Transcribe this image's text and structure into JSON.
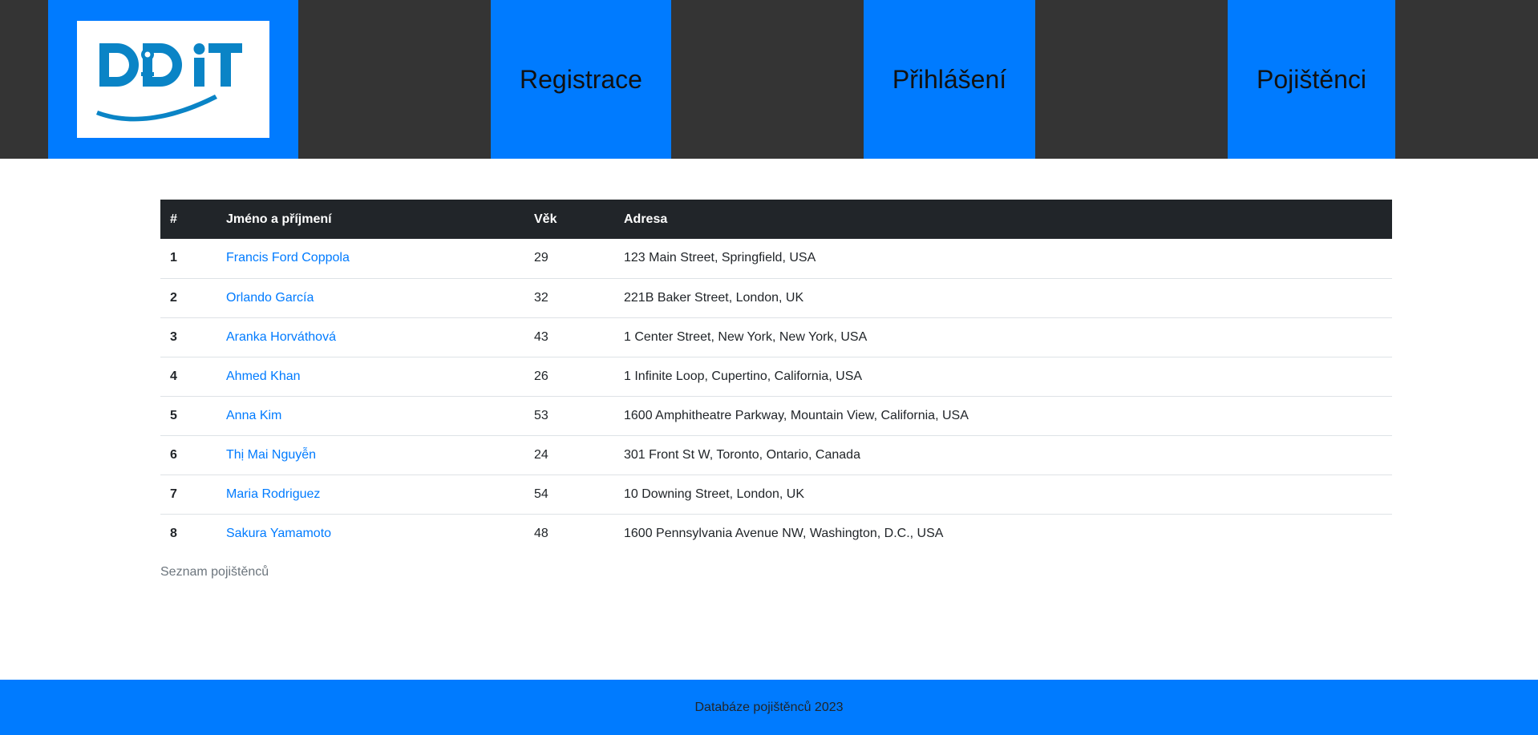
{
  "header": {
    "logo_alt": "DDiT",
    "nav": [
      {
        "label": "Registrace"
      },
      {
        "label": "Přihlášení"
      },
      {
        "label": "Pojištěnci"
      }
    ]
  },
  "table": {
    "headers": [
      "#",
      "Jméno a příjmení",
      "Věk",
      "Adresa"
    ],
    "rows": [
      {
        "num": "1",
        "name": "Francis Ford Coppola",
        "age": "29",
        "address": "123 Main Street, Springfield, USA"
      },
      {
        "num": "2",
        "name": "Orlando García",
        "age": "32",
        "address": "221B Baker Street, London, UK"
      },
      {
        "num": "3",
        "name": "Aranka Horváthová",
        "age": "43",
        "address": "1 Center Street, New York, New York, USA"
      },
      {
        "num": "4",
        "name": "Ahmed Khan",
        "age": "26",
        "address": "1 Infinite Loop, Cupertino, California, USA"
      },
      {
        "num": "5",
        "name": "Anna Kim",
        "age": "53",
        "address": "1600 Amphitheatre Parkway, Mountain View, California, USA"
      },
      {
        "num": "6",
        "name": "Thị Mai Nguyễn",
        "age": "24",
        "address": "301 Front St W, Toronto, Ontario, Canada"
      },
      {
        "num": "7",
        "name": "Maria Rodriguez",
        "age": "54",
        "address": "10 Downing Street, London, UK"
      },
      {
        "num": "8",
        "name": "Sakura Yamamoto",
        "age": "48",
        "address": "1600 Pennsylvania Avenue NW, Washington, D.C., USA"
      }
    ],
    "caption": "Seznam pojištěnců"
  },
  "footer": {
    "text": "Databáze pojištěnců 2023"
  },
  "colors": {
    "accent": "#007bff",
    "header_bg": "#343434",
    "table_head_bg": "#212529",
    "logo_blue": "#0a84c6"
  }
}
